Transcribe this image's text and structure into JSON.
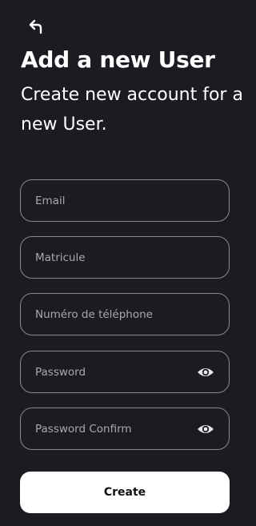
{
  "header": {
    "back_icon": "back-arrow-icon",
    "title": "Add a new User",
    "subtitle": "Create new account for a new User."
  },
  "form": {
    "email_placeholder": "Email",
    "matricule_placeholder": "Matricule",
    "phone_placeholder": "Numéro de téléphone",
    "password_placeholder": "Password",
    "password_confirm_placeholder": "Password Confirm",
    "eye_icon": "eye-icon"
  },
  "actions": {
    "create_label": "Create"
  },
  "colors": {
    "background": "#1c1b21",
    "field_border": "#8a8991",
    "placeholder": "#a9a8ae",
    "button_bg": "#ffffff",
    "button_text": "#111111"
  }
}
